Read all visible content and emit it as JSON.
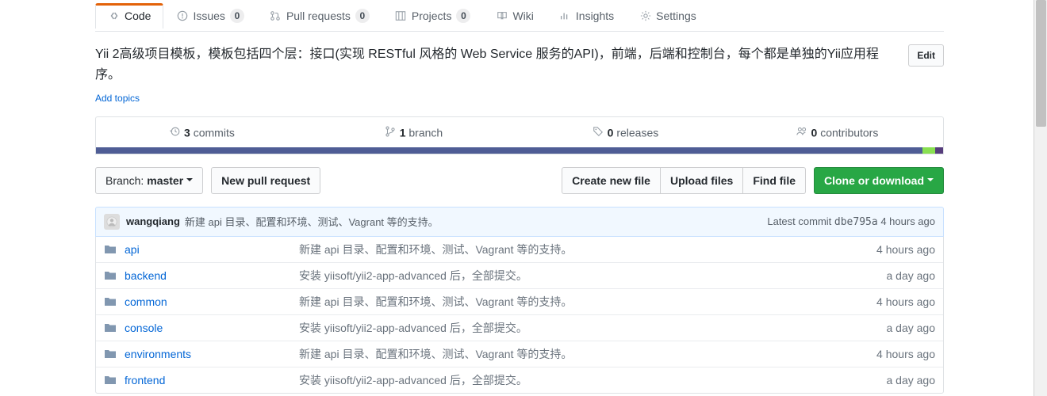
{
  "tabs": [
    {
      "label": "Code",
      "icon": "code",
      "selected": true
    },
    {
      "label": "Issues",
      "icon": "issue",
      "count": "0"
    },
    {
      "label": "Pull requests",
      "icon": "pr",
      "count": "0"
    },
    {
      "label": "Projects",
      "icon": "project",
      "count": "0"
    },
    {
      "label": "Wiki",
      "icon": "wiki"
    },
    {
      "label": "Insights",
      "icon": "graph"
    },
    {
      "label": "Settings",
      "icon": "gear"
    }
  ],
  "description": "Yii 2高级项目模板，模板包括四个层：接口(实现 RESTful 风格的 Web Service 服务的API)，前端，后端和控制台，每个都是单独的Yii应用程序。",
  "edit_label": "Edit",
  "add_topics_label": "Add topics",
  "stats": {
    "commits": {
      "count": "3",
      "label": "commits"
    },
    "branches": {
      "count": "1",
      "label": "branch"
    },
    "releases": {
      "count": "0",
      "label": "releases"
    },
    "contributors": {
      "count": "0",
      "label": "contributors"
    }
  },
  "lang_colors": [
    "#4F5D95",
    "#4F5D95",
    "#4F5D95",
    "#4F5D95",
    "#4F5D95",
    "#4F5D95",
    "#4F5D95",
    "#4F5D95",
    "#89e051",
    "#563d7c"
  ],
  "toolbar": {
    "branch_label": "Branch:",
    "branch_name": "master",
    "new_pr": "New pull request",
    "create_file": "Create new file",
    "upload": "Upload files",
    "find": "Find file",
    "clone": "Clone or download"
  },
  "commit": {
    "author": "wangqiang",
    "message": "新建 api 目录、配置和环境、测试、Vagrant 等的支持。",
    "latest_label": "Latest commit",
    "sha": "dbe795a",
    "age": "4 hours ago"
  },
  "files": [
    {
      "name": "api",
      "msg": "新建 api 目录、配置和环境、测试、Vagrant 等的支持。",
      "age": "4 hours ago"
    },
    {
      "name": "backend",
      "msg": "安装 yiisoft/yii2-app-advanced 后，全部提交。",
      "age": "a day ago"
    },
    {
      "name": "common",
      "msg": "新建 api 目录、配置和环境、测试、Vagrant 等的支持。",
      "age": "4 hours ago"
    },
    {
      "name": "console",
      "msg": "安装 yiisoft/yii2-app-advanced 后，全部提交。",
      "age": "a day ago"
    },
    {
      "name": "environments",
      "msg": "新建 api 目录、配置和环境、测试、Vagrant 等的支持。",
      "age": "4 hours ago"
    },
    {
      "name": "frontend",
      "msg": "安装 yiisoft/yii2-app-advanced 后，全部提交。",
      "age": "a day ago"
    }
  ]
}
